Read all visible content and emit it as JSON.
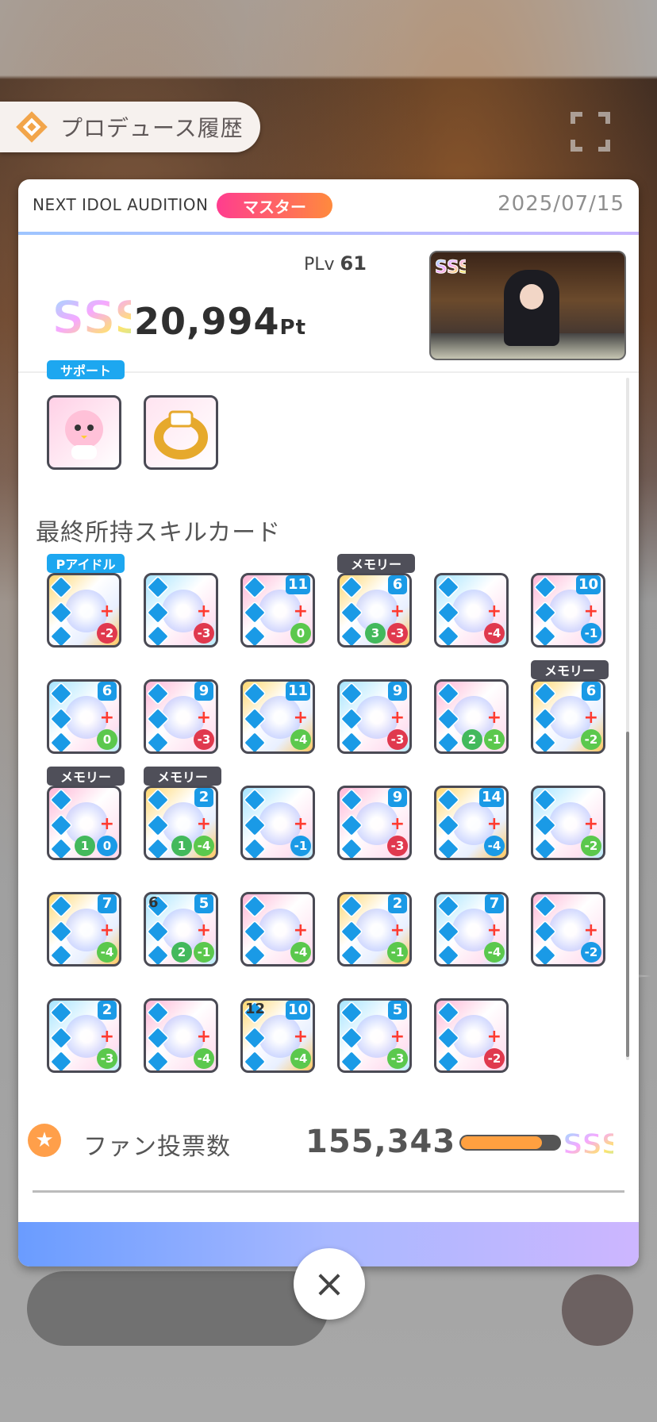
{
  "topbar": {
    "title": "プロデュース履歴"
  },
  "audition": {
    "name": "NEXT IDOL AUDITION",
    "difficulty": "マスター",
    "date": "2025/07/15"
  },
  "result": {
    "plv_label": "PLv",
    "plv_value": "61",
    "rank": "SSS",
    "score": "20,994",
    "score_unit": "Pt",
    "thumb_rank": "SSS"
  },
  "support": {
    "tag": "サポート",
    "items": [
      "support-card-pink-creature",
      "support-card-gold-ring"
    ]
  },
  "skills": {
    "title": "最終所持スキルカード",
    "tags": {
      "p_idol": "Pアイドル",
      "memory": "メモリー"
    },
    "rows": [
      [
        {
          "n": "",
          "s": "-2",
          "c": "red"
        },
        {
          "n": "",
          "s": "-3",
          "c": "red"
        },
        {
          "n": "11",
          "s": "0",
          "c": "green"
        },
        {
          "n": "6",
          "s": "-3",
          "c": "red",
          "s2": "3"
        },
        {
          "n": "",
          "s": "-4",
          "c": "red"
        },
        {
          "n": "10",
          "s": "-1",
          "c": "blue"
        }
      ],
      [
        {
          "n": "6",
          "s": "0",
          "c": "green"
        },
        {
          "n": "9",
          "s": "-3",
          "c": "red"
        },
        {
          "n": "11",
          "s": "-4",
          "c": "green"
        },
        {
          "n": "9",
          "s": "-3",
          "c": "red"
        },
        {
          "n": "",
          "s": "-1",
          "c": "green",
          "s2": "2"
        },
        {
          "n": "6",
          "s": "-2",
          "c": "green"
        }
      ],
      [
        {
          "n": "",
          "s": "0",
          "c": "blue",
          "s2": "1"
        },
        {
          "n": "2",
          "s": "-4",
          "c": "green",
          "s2": "1"
        },
        {
          "n": "",
          "s": "-1",
          "c": "blue"
        },
        {
          "n": "9",
          "s": "-3",
          "c": "red"
        },
        {
          "n": "14",
          "s": "-4",
          "c": "blue"
        },
        {
          "n": "",
          "s": "-2",
          "c": "green"
        }
      ],
      [
        {
          "n": "7",
          "s": "-4",
          "c": "green"
        },
        {
          "n": "5",
          "n2": "6",
          "s": "-1",
          "c": "green",
          "s2": "2"
        },
        {
          "n": "",
          "s": "-4",
          "c": "green"
        },
        {
          "n": "2",
          "s": "-1",
          "c": "green"
        },
        {
          "n": "7",
          "s": "-4",
          "c": "green"
        },
        {
          "n": "",
          "s": "-2",
          "c": "blue"
        }
      ],
      [
        {
          "n": "2",
          "s": "-3",
          "c": "green"
        },
        {
          "n": "",
          "s": "-4",
          "c": "green"
        },
        {
          "n": "10",
          "n2": "12",
          "s": "-4",
          "c": "green"
        },
        {
          "n": "5",
          "s": "-3",
          "c": "green"
        },
        {
          "n": "",
          "s": "-2",
          "c": "red"
        }
      ]
    ]
  },
  "fan": {
    "label": "ファン投票数",
    "value": "155,343",
    "progress": 0.82,
    "rank": "SSS"
  },
  "controls": {
    "close": "×"
  },
  "colors": {
    "accent_pink": "#ff3d8f",
    "accent_blue": "#1a9ae6",
    "footer_gradient_start": "#6a9cff",
    "footer_gradient_end": "#cdb6ff"
  }
}
